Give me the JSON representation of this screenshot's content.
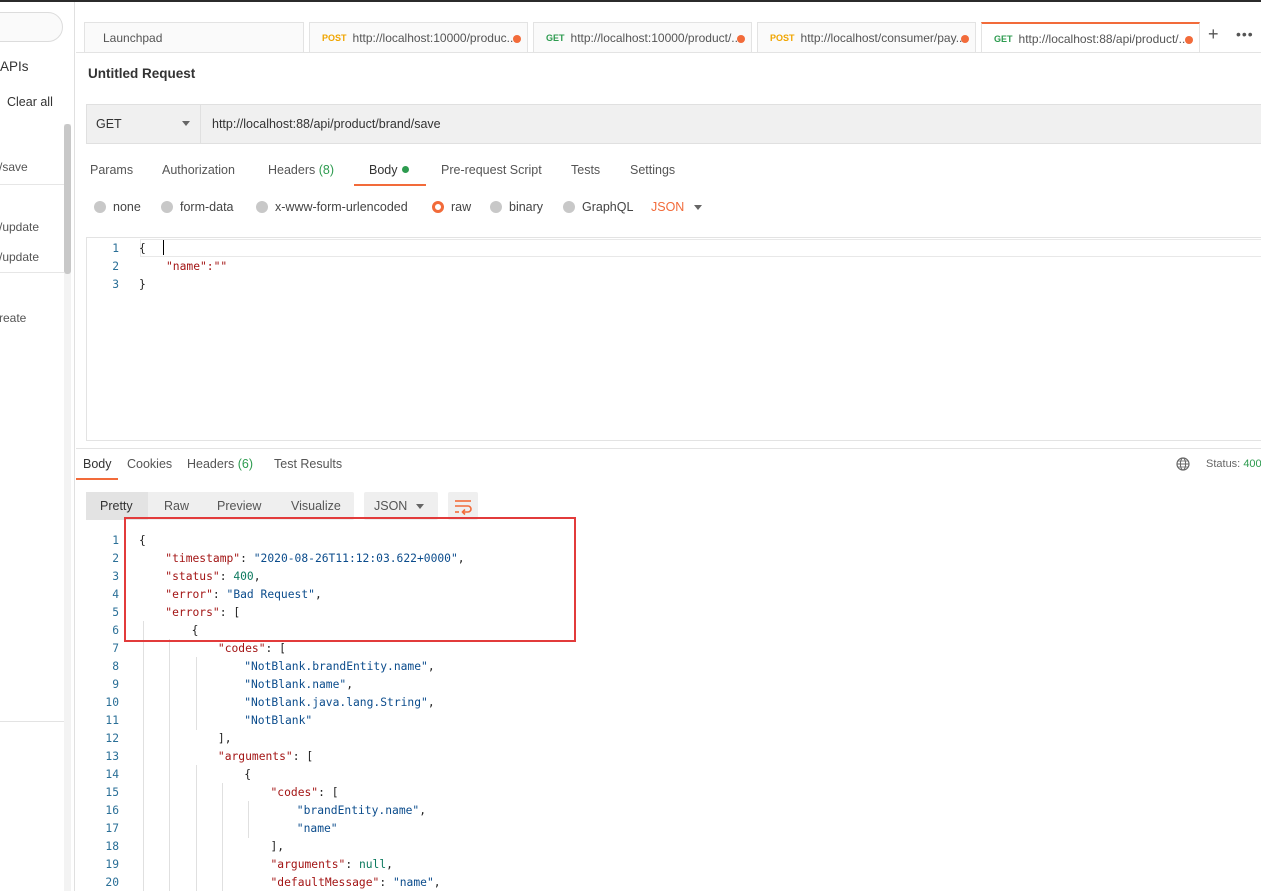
{
  "sidebar": {
    "apis_label": "APIs",
    "clear_all": "Clear all",
    "items": [
      "/save",
      "/update",
      "/update",
      "reate"
    ]
  },
  "tabs": [
    {
      "label": "Launchpad",
      "method": ""
    },
    {
      "label": "http://localhost:10000/produc...",
      "method": "POST"
    },
    {
      "label": "http://localhost:10000/product/...",
      "method": "GET"
    },
    {
      "label": "http://localhost/consumer/pay...",
      "method": "POST"
    },
    {
      "label": "http://localhost:88/api/product/...",
      "method": "GET"
    }
  ],
  "tab_actions": {
    "plus": "+",
    "more": "•••"
  },
  "request": {
    "title": "Untitled Request",
    "method": "GET",
    "url": "http://localhost:88/api/product/brand/save"
  },
  "request_tabs": [
    {
      "label": "Params",
      "count": ""
    },
    {
      "label": "Authorization",
      "count": ""
    },
    {
      "label": "Headers",
      "count": "(8)"
    },
    {
      "label": "Body",
      "count": ""
    },
    {
      "label": "Pre-request Script",
      "count": ""
    },
    {
      "label": "Tests",
      "count": ""
    },
    {
      "label": "Settings",
      "count": ""
    }
  ],
  "body_types": [
    "none",
    "form-data",
    "x-www-form-urlencoded",
    "raw",
    "binary",
    "GraphQL"
  ],
  "body_format": "JSON",
  "request_body_lines": [
    "{",
    "\"name\":\"\"",
    "}"
  ],
  "response_tabs": [
    {
      "label": "Body",
      "count": ""
    },
    {
      "label": "Cookies",
      "count": ""
    },
    {
      "label": "Headers",
      "count": "(6)"
    },
    {
      "label": "Test Results",
      "count": ""
    }
  ],
  "status": {
    "label": "Status:",
    "value": "400"
  },
  "view_modes": [
    "Pretty",
    "Raw",
    "Preview",
    "Visualize"
  ],
  "response_format": "JSON",
  "response_lines": [
    {
      "n": "1",
      "indent": 0,
      "parts": [
        [
          "p",
          "{"
        ]
      ]
    },
    {
      "n": "2",
      "indent": 1,
      "parts": [
        [
          "k",
          "\"timestamp\""
        ],
        [
          "p",
          ": "
        ],
        [
          "s",
          "\"2020-08-26T11:12:03.622+0000\""
        ],
        [
          "p",
          ","
        ]
      ]
    },
    {
      "n": "3",
      "indent": 1,
      "parts": [
        [
          "k",
          "\"status\""
        ],
        [
          "p",
          ": "
        ],
        [
          "v",
          "400"
        ],
        [
          "p",
          ","
        ]
      ]
    },
    {
      "n": "4",
      "indent": 1,
      "parts": [
        [
          "k",
          "\"error\""
        ],
        [
          "p",
          ": "
        ],
        [
          "s",
          "\"Bad Request\""
        ],
        [
          "p",
          ","
        ]
      ]
    },
    {
      "n": "5",
      "indent": 1,
      "parts": [
        [
          "k",
          "\"errors\""
        ],
        [
          "p",
          ": ["
        ]
      ]
    },
    {
      "n": "6",
      "indent": 2,
      "parts": [
        [
          "p",
          "{"
        ]
      ]
    },
    {
      "n": "7",
      "indent": 3,
      "parts": [
        [
          "k",
          "\"codes\""
        ],
        [
          "p",
          ": ["
        ]
      ]
    },
    {
      "n": "8",
      "indent": 4,
      "parts": [
        [
          "s",
          "\"NotBlank.brandEntity.name\""
        ],
        [
          "p",
          ","
        ]
      ]
    },
    {
      "n": "9",
      "indent": 4,
      "parts": [
        [
          "s",
          "\"NotBlank.name\""
        ],
        [
          "p",
          ","
        ]
      ]
    },
    {
      "n": "10",
      "indent": 4,
      "parts": [
        [
          "s",
          "\"NotBlank.java.lang.String\""
        ],
        [
          "p",
          ","
        ]
      ]
    },
    {
      "n": "11",
      "indent": 4,
      "parts": [
        [
          "s",
          "\"NotBlank\""
        ]
      ]
    },
    {
      "n": "12",
      "indent": 3,
      "parts": [
        [
          "p",
          "],"
        ]
      ]
    },
    {
      "n": "13",
      "indent": 3,
      "parts": [
        [
          "k",
          "\"arguments\""
        ],
        [
          "p",
          ": ["
        ]
      ]
    },
    {
      "n": "14",
      "indent": 4,
      "parts": [
        [
          "p",
          "{"
        ]
      ]
    },
    {
      "n": "15",
      "indent": 5,
      "parts": [
        [
          "k",
          "\"codes\""
        ],
        [
          "p",
          ": ["
        ]
      ]
    },
    {
      "n": "16",
      "indent": 6,
      "parts": [
        [
          "s",
          "\"brandEntity.name\""
        ],
        [
          "p",
          ","
        ]
      ]
    },
    {
      "n": "17",
      "indent": 6,
      "parts": [
        [
          "s",
          "\"name\""
        ]
      ]
    },
    {
      "n": "18",
      "indent": 5,
      "parts": [
        [
          "p",
          "],"
        ]
      ]
    },
    {
      "n": "19",
      "indent": 5,
      "parts": [
        [
          "k",
          "\"arguments\""
        ],
        [
          "p",
          ": "
        ],
        [
          "v",
          "null"
        ],
        [
          "p",
          ","
        ]
      ]
    },
    {
      "n": "20",
      "indent": 5,
      "parts": [
        [
          "k",
          "\"defaultMessage\""
        ],
        [
          "p",
          ": "
        ],
        [
          "s",
          "\"name\""
        ],
        [
          "p",
          ","
        ]
      ]
    }
  ],
  "colors": {
    "accent": "#f26b3a",
    "post": "#f0a500",
    "get": "#2d9b4f",
    "highlight": "#e23b3b"
  }
}
